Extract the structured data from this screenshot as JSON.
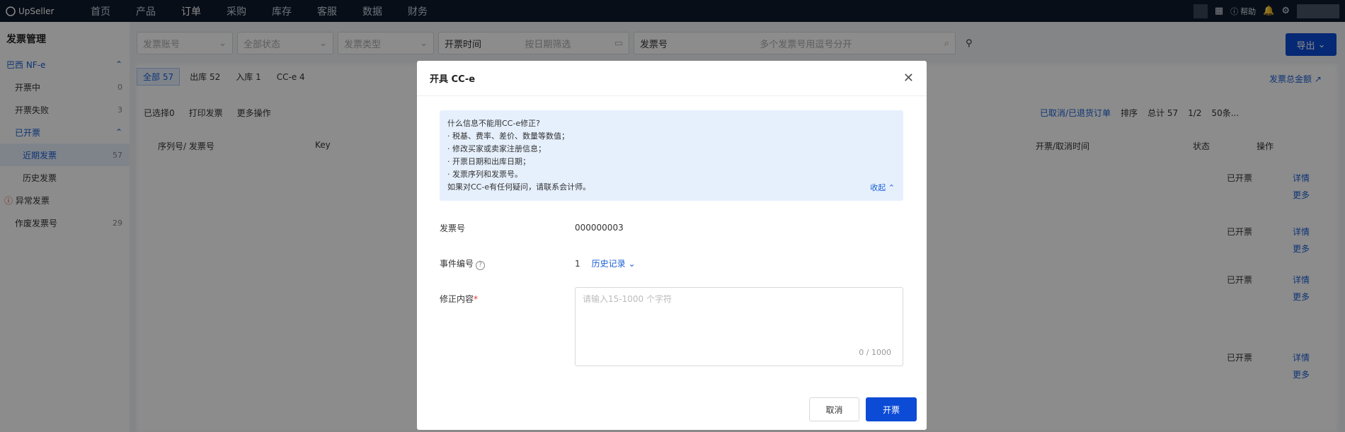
{
  "topbar": {
    "logo": "UpSeller",
    "nav": [
      "首页",
      "产品",
      "订单",
      "采购",
      "库存",
      "客服",
      "数据",
      "财务"
    ],
    "help": "帮助"
  },
  "sidebar": {
    "title": "发票管理",
    "group": "巴西 NF-e",
    "items": [
      {
        "label": "开票中",
        "count": "0"
      },
      {
        "label": "开票失败",
        "count": "3"
      },
      {
        "label": "已开票",
        "count": ""
      },
      {
        "label": "近期发票",
        "count": "57"
      },
      {
        "label": "历史发票",
        "count": ""
      },
      {
        "label": "异常发票",
        "count": ""
      },
      {
        "label": "作废发票号",
        "count": "29"
      }
    ]
  },
  "filters": {
    "account": "发票账号",
    "status": "全部状态",
    "type": "发票类型",
    "time": "开票时间",
    "date": "按日期筛选",
    "invoice_no": "发票号",
    "search": "多个发票号用逗号分开"
  },
  "export": "导出",
  "tabs": [
    {
      "label": "全部",
      "count": "57"
    },
    {
      "label": "出库",
      "count": "52"
    },
    {
      "label": "入库",
      "count": "1"
    },
    {
      "label": "CC-e",
      "count": "4"
    }
  ],
  "total_link": "发票总金额",
  "toolbar": {
    "selected": "已选择0",
    "print": "打印发票",
    "more": "更多操作",
    "cancelled_link": "已取消/已退货订单",
    "sort": "排序",
    "total": "总计 57",
    "page": "1/2",
    "pagesize": "50条..."
  },
  "table": {
    "headers": [
      "序列号/ 发票号",
      "Key",
      "开票/取消时间",
      "状态",
      "操作"
    ],
    "rows": [
      {
        "status": "已开票",
        "detail": "详情",
        "more": "更多"
      },
      {
        "status": "已开票",
        "detail": "详情",
        "more": "更多"
      },
      {
        "status": "已开票",
        "detail": "详情",
        "more": "更多"
      },
      {
        "status": "已开票",
        "detail": "详情",
        "more": "更多"
      }
    ]
  },
  "dialog": {
    "title": "开具 CC-e",
    "info_lines": [
      "什么信息不能用CC-e修正?",
      "· 税基、费率、差价、数量等数值；",
      "· 修改买家或卖家注册信息；",
      "· 开票日期和出库日期；",
      "· 发票序列和发票号。",
      "如果对CC-e有任何疑问，请联系会计师。"
    ],
    "collapse": "收起",
    "invoice_no_label": "发票号",
    "invoice_no_value": "000000003",
    "event_label": "事件编号",
    "event_value": "1",
    "history": "历史记录",
    "correction_label": "修正内容",
    "placeholder": "请输入15-1000 个字符",
    "counter": "0 / 1000",
    "cancel": "取消",
    "submit": "开票"
  }
}
